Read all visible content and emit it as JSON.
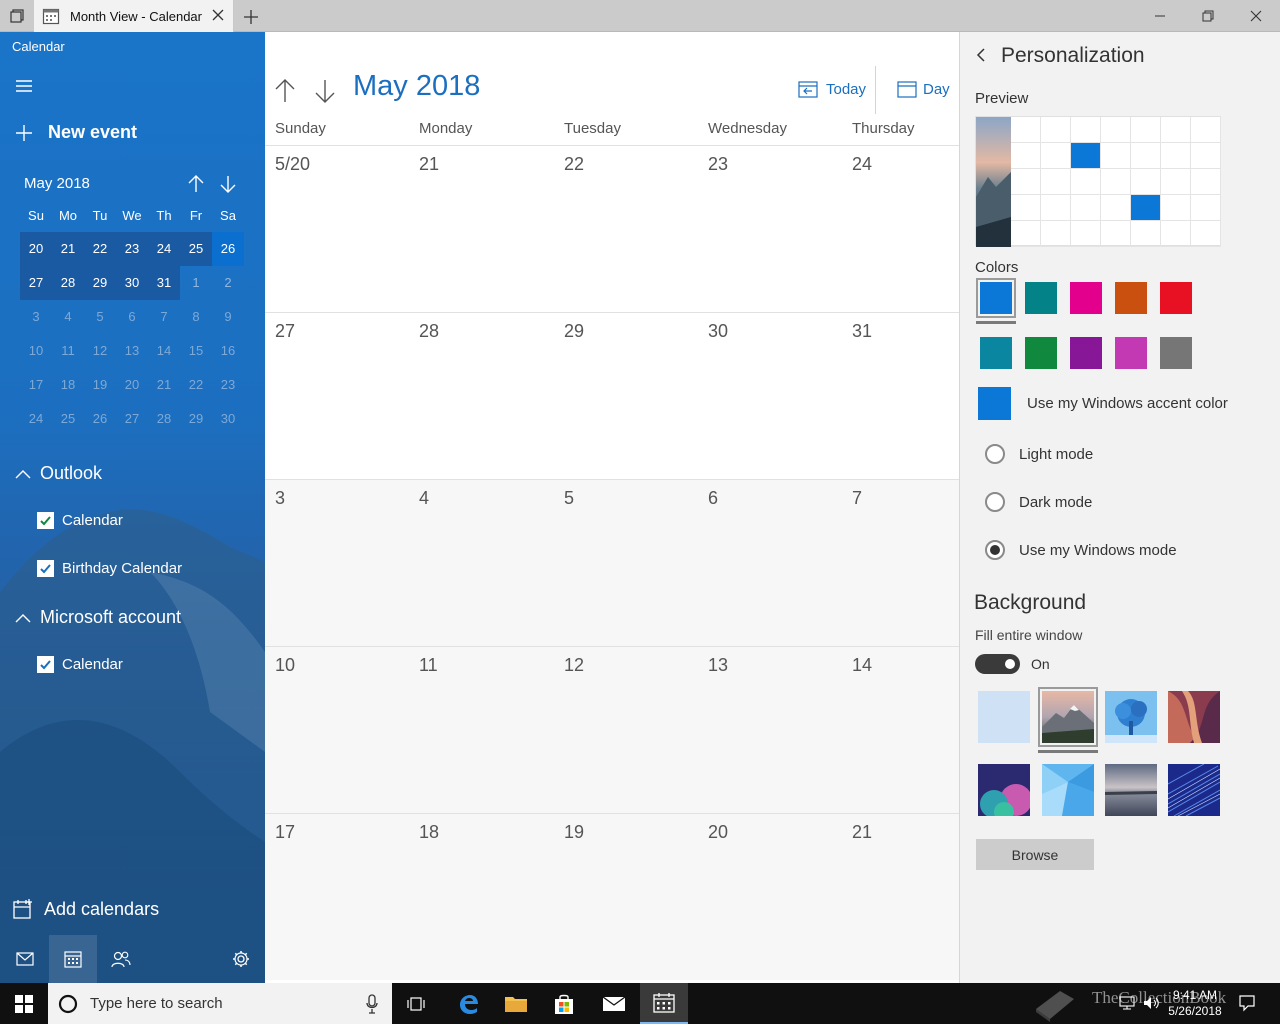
{
  "window": {
    "tab_title": "Month View - Calendar"
  },
  "sidebar": {
    "app_title": "Calendar",
    "new_event_label": "New event",
    "mini": {
      "title": "May 2018",
      "dow": [
        "Su",
        "Mo",
        "Tu",
        "We",
        "Th",
        "Fr",
        "Sa"
      ],
      "weeks": [
        [
          "20",
          "21",
          "22",
          "23",
          "24",
          "25",
          "26"
        ],
        [
          "27",
          "28",
          "29",
          "30",
          "31",
          "1",
          "2"
        ],
        [
          "3",
          "4",
          "5",
          "6",
          "7",
          "8",
          "9"
        ],
        [
          "10",
          "11",
          "12",
          "13",
          "14",
          "15",
          "16"
        ],
        [
          "17",
          "18",
          "19",
          "20",
          "21",
          "22",
          "23"
        ],
        [
          "24",
          "25",
          "26",
          "27",
          "28",
          "29",
          "30"
        ]
      ],
      "today": "26"
    },
    "groups": [
      {
        "label": "Outlook",
        "calendars": [
          "Calendar",
          "Birthday Calendar"
        ]
      },
      {
        "label": "Microsoft account",
        "calendars": [
          "Calendar"
        ]
      }
    ],
    "add_calendars_label": "Add calendars"
  },
  "main": {
    "month_title": "May 2018",
    "today_label": "Today",
    "day_label": "Day",
    "dow": [
      "Sunday",
      "Monday",
      "Tuesday",
      "Wednesday",
      "Thursday"
    ],
    "weeks": [
      [
        "5/20",
        "21",
        "22",
        "23",
        "24"
      ],
      [
        "27",
        "28",
        "29",
        "30",
        "31"
      ],
      [
        "3",
        "4",
        "5",
        "6",
        "7"
      ],
      [
        "10",
        "11",
        "12",
        "13",
        "14"
      ],
      [
        "17",
        "18",
        "19",
        "20",
        "21"
      ]
    ]
  },
  "panel": {
    "title": "Personalization",
    "preview_label": "Preview",
    "colors_label": "Colors",
    "colors_row1": [
      "#0b78d7",
      "#038387",
      "#e3008c",
      "#ca5010",
      "#e81123"
    ],
    "colors_row2": [
      "#0b86a1",
      "#10893e",
      "#881798",
      "#c239b3",
      "#767676"
    ],
    "accent_label": "Use my Windows accent color",
    "modes": [
      "Light mode",
      "Dark mode",
      "Use my Windows mode"
    ],
    "selected_mode": "Use my Windows mode",
    "background_title": "Background",
    "fill_label": "Fill entire window",
    "toggle_label": "On",
    "browse_label": "Browse"
  },
  "taskbar": {
    "search_placeholder": "Type here to search",
    "time": "9:41 AM",
    "date": "5/26/2018",
    "watermark": "TheCollectionBook"
  }
}
